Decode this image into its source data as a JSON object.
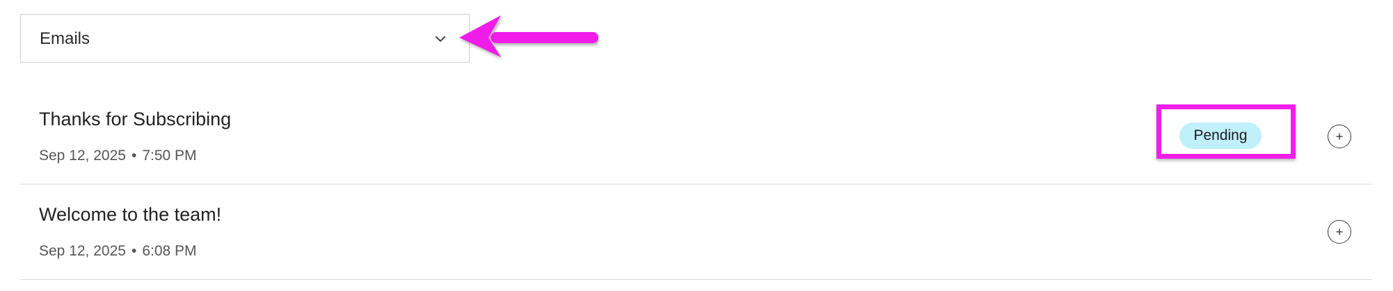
{
  "filter": {
    "selected": "Emails",
    "icon": "chevron-down-icon"
  },
  "emails": [
    {
      "title": "Thanks for Subscribing",
      "date": "Sep 12, 2025",
      "separator": "•",
      "time": "7:50 PM",
      "status": "Pending"
    },
    {
      "title": "Welcome to the team!",
      "date": "Sep 12, 2025",
      "separator": "•",
      "time": "6:08 PM"
    }
  ],
  "colors": {
    "annotation": "#f01ee8",
    "status_pending_bg": "#bff0fb",
    "divider": "#dcdcdc"
  }
}
